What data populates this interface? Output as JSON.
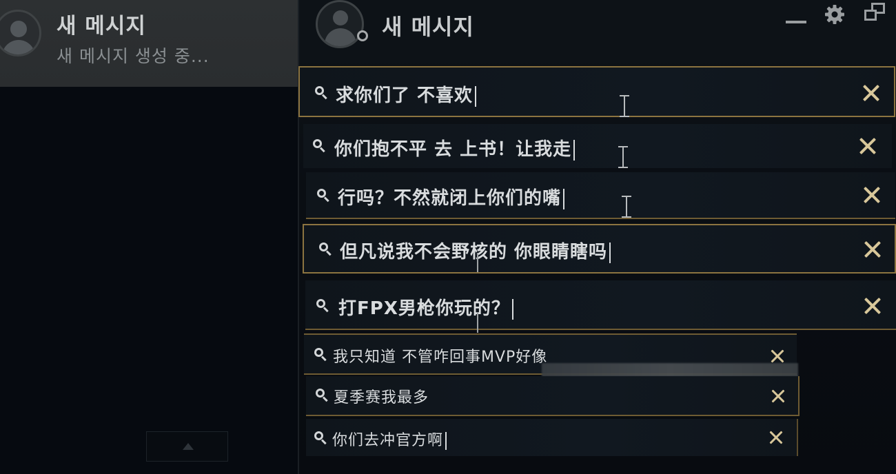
{
  "left_panel": {
    "title": "새 메시지",
    "subtitle": "새 메시지 생성 중..."
  },
  "chat_window": {
    "title": "새 메시지"
  },
  "icons": {
    "minimize": "minimize-icon",
    "settings": "gear-icon",
    "restore": "restore-icon",
    "search": "search-icon",
    "close": "close-icon",
    "scroll_up": "triangle-up-icon"
  },
  "colors": {
    "accent_gold": "#8c7440",
    "close_x": "#d8c79a",
    "text": "#d9dcde"
  },
  "search_bars": [
    {
      "text": "求你们了 不喜欢"
    },
    {
      "text": "你们抱不平 去 上书！让我走"
    },
    {
      "text": "行吗？不然就闭上你们的嘴"
    },
    {
      "text": "但凡说我不会野核的 你眼睛瞎吗"
    },
    {
      "text": "打FPX男枪你玩的？"
    },
    {
      "text": "我只知道 不管咋回事MVP好像"
    },
    {
      "text": "夏季赛我最多"
    },
    {
      "text": "你们去冲官方啊"
    }
  ]
}
